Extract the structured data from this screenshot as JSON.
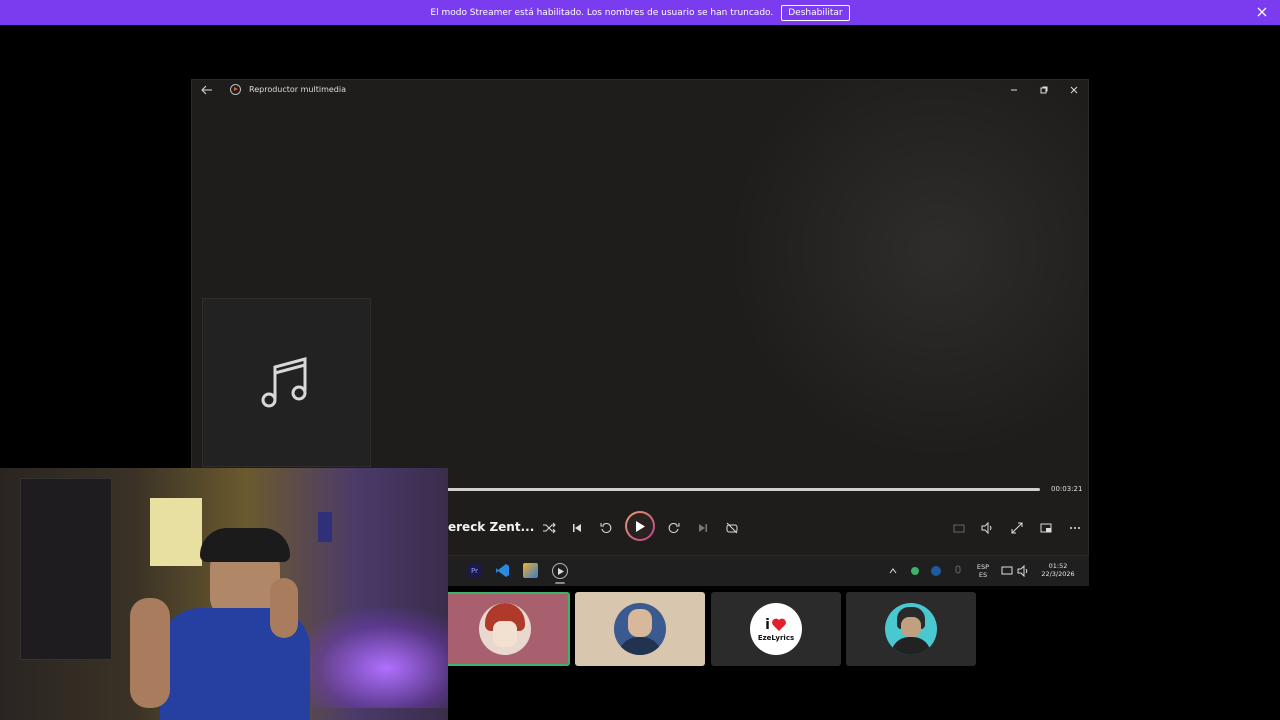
{
  "banner": {
    "message": "El modo Streamer está habilitado. Los nombres de usuario se han truncado.",
    "button_label": "Deshabilitar",
    "close_icon": "close-icon"
  },
  "player": {
    "title": "Reproductor multimedia",
    "track_title": "ereck Zent...",
    "duration": "00:03:21",
    "progress_fraction": 1.0,
    "album_art_icon": "music-note-icon"
  },
  "taskbar": {
    "language": "ESP",
    "language_sub": "ES",
    "time": "01:52",
    "date": "22/3/2026"
  },
  "tiles": [
    {
      "name": "tile-1",
      "avatar": "anime-avatar",
      "bg": "#a8606e"
    },
    {
      "name": "tile-2",
      "avatar": "man-avatar",
      "bg": "#d8c6ae"
    },
    {
      "name": "tile-3",
      "avatar": "ezelyrics-avatar",
      "bg": "#2b2b2b",
      "label_top": "i",
      "label_bottom": "EzeLyrics"
    },
    {
      "name": "tile-4",
      "avatar": "person-avatar",
      "bg": "#2b2b2b"
    }
  ],
  "colors": {
    "banner": "#7b3cf0",
    "accent_play_start": "#f0a070",
    "accent_play_end": "#b53c8c",
    "active_tile_border": "#3bb36b"
  }
}
